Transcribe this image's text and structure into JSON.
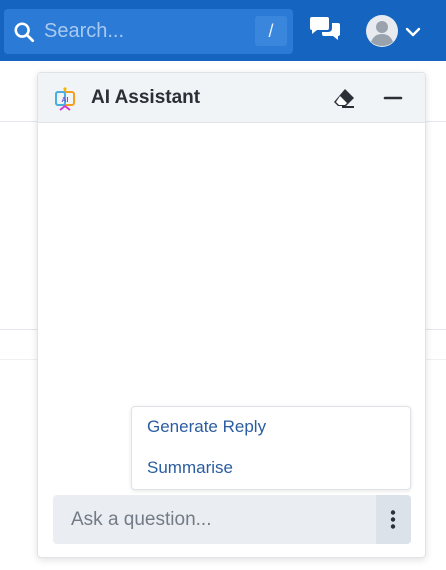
{
  "topbar": {
    "search_placeholder": "Search...",
    "search_shortcut": "/",
    "icons": {
      "search": "search-icon",
      "chat": "chat-bubbles-icon",
      "avatar": "user-avatar-icon",
      "dropdown": "chevron-down-icon"
    },
    "colors": {
      "bar": "#1565c0",
      "search_bg": "#2a7ad6"
    }
  },
  "assistant": {
    "title": "AI Assistant",
    "icons": {
      "logo": "ai-logo-icon",
      "clear": "eraser-icon",
      "minimize": "minimize-icon"
    },
    "suggestions": [
      "Generate Reply",
      "Summarise"
    ],
    "input_placeholder": "Ask a question...",
    "more_icon": "more-vertical-icon",
    "colors": {
      "suggestion_text": "#2a5d9f",
      "header_bg": "#f1f4f7"
    }
  }
}
